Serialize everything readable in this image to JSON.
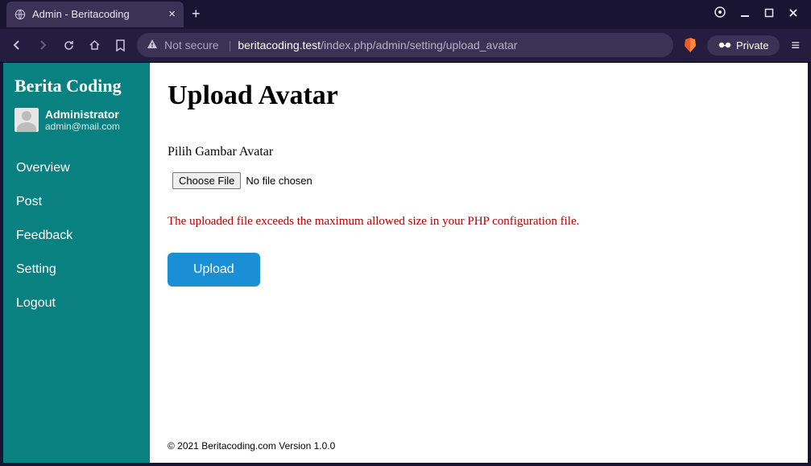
{
  "browser": {
    "tab_title": "Admin - Beritacoding",
    "not_secure_label": "Not secure",
    "url_domain": "beritacoding.test",
    "url_path": "/index.php/admin/setting/upload_avatar",
    "private_label": "Private"
  },
  "sidebar": {
    "brand": "Berita Coding",
    "user_name": "Administrator",
    "user_email": "admin@mail.com",
    "items": [
      {
        "label": "Overview"
      },
      {
        "label": "Post"
      },
      {
        "label": "Feedback"
      },
      {
        "label": "Setting"
      },
      {
        "label": "Logout"
      }
    ]
  },
  "main": {
    "title": "Upload Avatar",
    "field_label": "Pilih Gambar Avatar",
    "choose_file_label": "Choose File",
    "file_status": "No file chosen",
    "error_message": "The uploaded file exceeds the maximum allowed size in your PHP configuration file.",
    "upload_label": "Upload",
    "footer": "© 2021 Beritacoding.com Version 1.0.0"
  }
}
